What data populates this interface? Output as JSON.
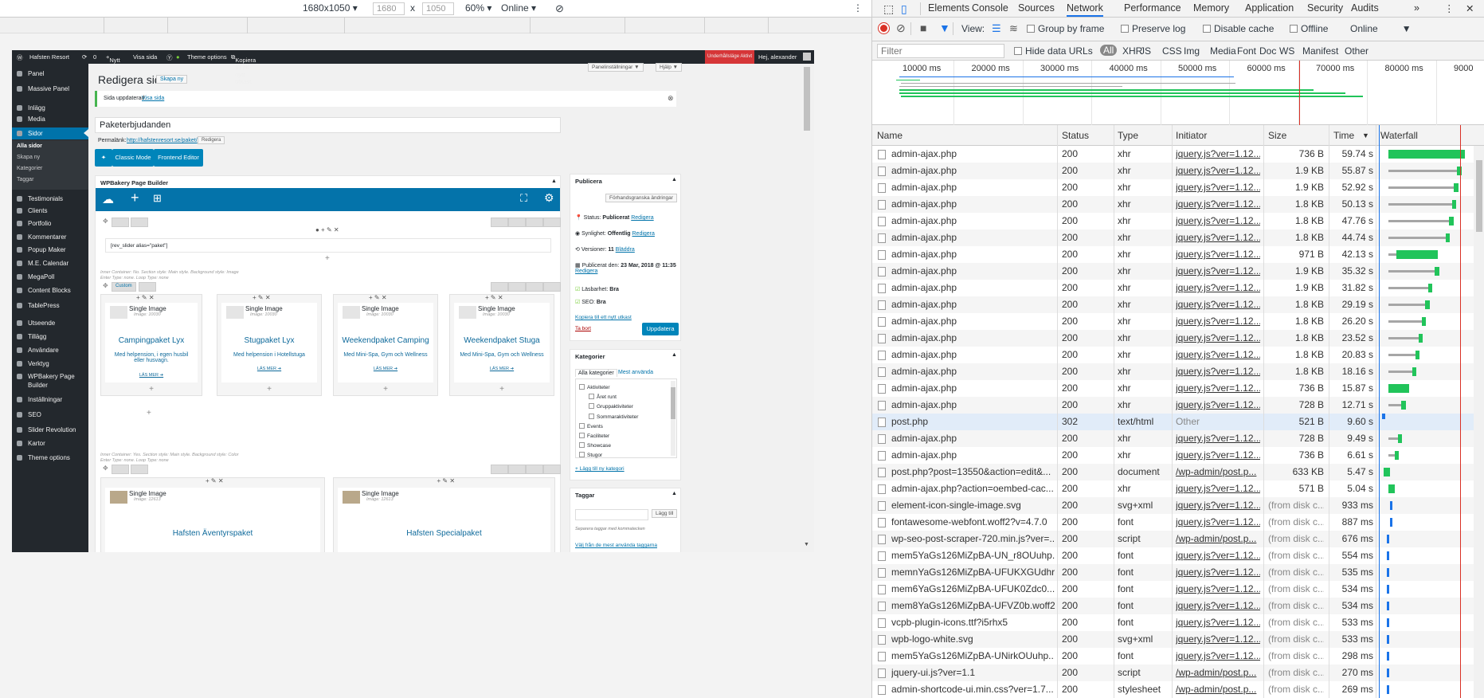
{
  "device_toolbar": {
    "preset": "1680x1050",
    "width": "1680",
    "x": "x",
    "height": "1050",
    "zoom": "60%",
    "network": "Online"
  },
  "wp": {
    "adminbar": {
      "site": "Hafsten Resort",
      "comments": "0",
      "new": "Nytt",
      "view": "Visa sida",
      "theme": "Theme options",
      "copy": "Kopiera till ett nytt utkast",
      "warn": "Underhållsläge Aktivt",
      "user": "Hej, alexander"
    },
    "menu": [
      {
        "label": "Panel",
        "icon": "dashboard-icon"
      },
      {
        "label": "Massive Panel",
        "icon": "panel-icon"
      },
      {
        "label": "Inlägg",
        "icon": "pin-icon"
      },
      {
        "label": "Media",
        "icon": "media-icon"
      },
      {
        "label": "Sidor",
        "icon": "pages-icon"
      },
      {
        "label": "Testimonials",
        "icon": "quote-icon"
      },
      {
        "label": "Clients",
        "icon": "clients-icon"
      },
      {
        "label": "Portfolio",
        "icon": "portfolio-icon"
      },
      {
        "label": "Kommentarer",
        "icon": "comment-icon"
      },
      {
        "label": "Popup Maker",
        "icon": "popup-icon"
      },
      {
        "label": "M.E. Calendar",
        "icon": "calendar-icon"
      },
      {
        "label": "MegaPoll",
        "icon": "poll-icon"
      },
      {
        "label": "Content Blocks",
        "icon": "blocks-icon"
      },
      {
        "label": "TablePress",
        "icon": "table-icon"
      },
      {
        "label": "Utseende",
        "icon": "brush-icon"
      },
      {
        "label": "Tillägg",
        "icon": "plugin-icon"
      },
      {
        "label": "Användare",
        "icon": "users-icon"
      },
      {
        "label": "Verktyg",
        "icon": "tools-icon"
      },
      {
        "label": "WPBakery Page Builder",
        "icon": "wpb-icon"
      },
      {
        "label": "Inställningar",
        "icon": "settings-icon"
      },
      {
        "label": "SEO",
        "icon": "seo-icon"
      },
      {
        "label": "Slider Revolution",
        "icon": "slider-icon"
      },
      {
        "label": "Kartor",
        "icon": "map-icon"
      },
      {
        "label": "Theme options",
        "icon": "theme-icon"
      }
    ],
    "submenu": [
      "Alla sidor",
      "Skapa ny",
      "Kategorier",
      "Taggar"
    ],
    "heading": "Redigera sida",
    "add_new": "Skapa ny",
    "screen_options": "Panelinställningar ▼",
    "help": "Hjälp ▼",
    "notice": "Sida uppdaterad.",
    "notice_link": "Visa sida",
    "title": "Paketerbjudanden",
    "permalink_label": "Permalänk:",
    "permalink": "http://hafstenresort.se/paket/",
    "edit": "Redigera",
    "classic_mode": "Classic Mode",
    "frontend_editor": "Frontend Editor",
    "wpb_title": "WPBakery Page Builder",
    "shortcode": "[rev_slider alias=\"paket\"]",
    "inner1": "Inner Container: No. Section style: Main style. Background style: Image",
    "inner1b": "Enter Type: none. Loop Type: none",
    "custom": "Custom",
    "cards": [
      {
        "img": "Single Image",
        "sub": "Image: 10030",
        "title": "Campingpaket Lyx",
        "desc": "Med helpension, i egen husbil eller husvagn.",
        "more": "LÄS MER ➔"
      },
      {
        "img": "Single Image",
        "sub": "Image: 10030",
        "title": "Stugpaket Lyx",
        "desc": "Med helpension i Hotellstuga",
        "more": "LÄS MER ➔"
      },
      {
        "img": "Single Image",
        "sub": "Image: 10030",
        "title": "Weekendpaket Camping",
        "desc": "Med Mini-Spa, Gym och Wellness",
        "more": "LÄS MER ➔"
      },
      {
        "img": "Single Image",
        "sub": "Image: 10030",
        "title": "Weekendpaket Stuga",
        "desc": "Med Mini-Spa, Gym och Wellness",
        "more": "LÄS MER ➔"
      }
    ],
    "inner2": "Inner Container: Yes. Section style: Main style. Background style: Color",
    "inner2b": "Enter Type: none. Loop Type: none",
    "cards2": [
      {
        "img": "Single Image",
        "sub": "Image: 12613",
        "title": "Hafsten Äventyrspaket"
      },
      {
        "img": "Single Image",
        "sub": "Image: 12613",
        "title": "Hafsten Specialpaket"
      }
    ],
    "publish": {
      "title": "Publicera",
      "preview": "Förhandsgranska ändringar",
      "status_l": "Status:",
      "status": "Publicerat",
      "vis_l": "Synlighet:",
      "vis": "Offentlig",
      "rev_l": "Versioner:",
      "rev": "11",
      "browse": "Bläddra",
      "pub_l": "Publicerat den:",
      "pub": "23 Mar, 2018 @ 11:35",
      "read_l": "Läsbarhet:",
      "read": "Bra",
      "seo_l": "SEO:",
      "seo": "Bra",
      "copy": "Kopiera till ett nytt utkast",
      "trash": "Ta bort",
      "update": "Uppdatera"
    },
    "categories": {
      "title": "Kategorier",
      "all": "Alla kategorier",
      "most": "Mest använda",
      "items": [
        "Aktiviteter",
        "Året runt",
        "Gruppaktiviteter",
        "Sommaraktiviteter",
        "Events",
        "Faciliteter",
        "Showcase",
        "Stugor"
      ],
      "add": "+ Lägg till ny kategori"
    },
    "tags": {
      "title": "Taggar",
      "add": "Lägg till",
      "hint": "Separera taggar med kommatecken",
      "choose": "Välj från de mest använda taggarna"
    }
  },
  "devtools": {
    "tabs": [
      "Elements",
      "Console",
      "Sources",
      "Network",
      "Performance",
      "Memory",
      "Application",
      "Security",
      "Audits"
    ],
    "active_tab": "Network",
    "view_label": "View:",
    "group_by_frame": "Group by frame",
    "preserve_log": "Preserve log",
    "disable_cache": "Disable cache",
    "offline": "Offline",
    "online": "Online",
    "filter_placeholder": "Filter",
    "hide_data_urls": "Hide data URLs",
    "filters": [
      "All",
      "XHR",
      "JS",
      "CSS",
      "Img",
      "Media",
      "Font",
      "Doc",
      "WS",
      "Manifest",
      "Other"
    ],
    "timeline_ticks": [
      "10000 ms",
      "20000 ms",
      "30000 ms",
      "40000 ms",
      "50000 ms",
      "60000 ms",
      "70000 ms",
      "80000 ms",
      "9000"
    ],
    "columns": [
      "Name",
      "Status",
      "Type",
      "Initiator",
      "Size",
      "Time",
      "Waterfall"
    ],
    "rows": [
      {
        "name": "admin-ajax.php",
        "status": "200",
        "type": "xhr",
        "init": "jquery.js?ver=1.12....",
        "size": "736 B",
        "time": "59.74 s"
      },
      {
        "name": "admin-ajax.php",
        "status": "200",
        "type": "xhr",
        "init": "jquery.js?ver=1.12....",
        "size": "1.9 KB",
        "time": "55.87 s"
      },
      {
        "name": "admin-ajax.php",
        "status": "200",
        "type": "xhr",
        "init": "jquery.js?ver=1.12....",
        "size": "1.9 KB",
        "time": "52.92 s"
      },
      {
        "name": "admin-ajax.php",
        "status": "200",
        "type": "xhr",
        "init": "jquery.js?ver=1.12....",
        "size": "1.8 KB",
        "time": "50.13 s"
      },
      {
        "name": "admin-ajax.php",
        "status": "200",
        "type": "xhr",
        "init": "jquery.js?ver=1.12....",
        "size": "1.8 KB",
        "time": "47.76 s"
      },
      {
        "name": "admin-ajax.php",
        "status": "200",
        "type": "xhr",
        "init": "jquery.js?ver=1.12....",
        "size": "1.8 KB",
        "time": "44.74 s"
      },
      {
        "name": "admin-ajax.php",
        "status": "200",
        "type": "xhr",
        "init": "jquery.js?ver=1.12....",
        "size": "971 B",
        "time": "42.13 s"
      },
      {
        "name": "admin-ajax.php",
        "status": "200",
        "type": "xhr",
        "init": "jquery.js?ver=1.12....",
        "size": "1.9 KB",
        "time": "35.32 s"
      },
      {
        "name": "admin-ajax.php",
        "status": "200",
        "type": "xhr",
        "init": "jquery.js?ver=1.12....",
        "size": "1.9 KB",
        "time": "31.82 s"
      },
      {
        "name": "admin-ajax.php",
        "status": "200",
        "type": "xhr",
        "init": "jquery.js?ver=1.12....",
        "size": "1.8 KB",
        "time": "29.19 s"
      },
      {
        "name": "admin-ajax.php",
        "status": "200",
        "type": "xhr",
        "init": "jquery.js?ver=1.12....",
        "size": "1.8 KB",
        "time": "26.20 s"
      },
      {
        "name": "admin-ajax.php",
        "status": "200",
        "type": "xhr",
        "init": "jquery.js?ver=1.12....",
        "size": "1.8 KB",
        "time": "23.52 s"
      },
      {
        "name": "admin-ajax.php",
        "status": "200",
        "type": "xhr",
        "init": "jquery.js?ver=1.12....",
        "size": "1.8 KB",
        "time": "20.83 s"
      },
      {
        "name": "admin-ajax.php",
        "status": "200",
        "type": "xhr",
        "init": "jquery.js?ver=1.12....",
        "size": "1.8 KB",
        "time": "18.16 s"
      },
      {
        "name": "admin-ajax.php",
        "status": "200",
        "type": "xhr",
        "init": "jquery.js?ver=1.12....",
        "size": "736 B",
        "time": "15.87 s"
      },
      {
        "name": "admin-ajax.php",
        "status": "200",
        "type": "xhr",
        "init": "jquery.js?ver=1.12....",
        "size": "728 B",
        "time": "12.71 s"
      },
      {
        "name": "post.php",
        "status": "302",
        "type": "text/html",
        "init": "Other",
        "size": "521 B",
        "time": "9.60 s"
      },
      {
        "name": "admin-ajax.php",
        "status": "200",
        "type": "xhr",
        "init": "jquery.js?ver=1.12....",
        "size": "728 B",
        "time": "9.49 s"
      },
      {
        "name": "admin-ajax.php",
        "status": "200",
        "type": "xhr",
        "init": "jquery.js?ver=1.12....",
        "size": "736 B",
        "time": "6.61 s"
      },
      {
        "name": "post.php?post=13550&action=edit&...",
        "status": "200",
        "type": "document",
        "init": "/wp-admin/post.p...",
        "size": "633 KB",
        "time": "5.47 s"
      },
      {
        "name": "admin-ajax.php?action=oembed-cac...",
        "status": "200",
        "type": "xhr",
        "init": "jquery.js?ver=1.12....",
        "size": "571 B",
        "time": "5.04 s"
      },
      {
        "name": "element-icon-single-image.svg",
        "status": "200",
        "type": "svg+xml",
        "init": "jquery.js?ver=1.12....",
        "size": "(from disk c...",
        "time": "933 ms"
      },
      {
        "name": "fontawesome-webfont.woff2?v=4.7.0",
        "status": "200",
        "type": "font",
        "init": "jquery.js?ver=1.12....",
        "size": "(from disk c...",
        "time": "887 ms"
      },
      {
        "name": "wp-seo-post-scraper-720.min.js?ver=...",
        "status": "200",
        "type": "script",
        "init": "/wp-admin/post.p...",
        "size": "(from disk c...",
        "time": "676 ms"
      },
      {
        "name": "mem5YaGs126MiZpBA-UN_r8OUuhp...",
        "status": "200",
        "type": "font",
        "init": "jquery.js?ver=1.12....",
        "size": "(from disk c...",
        "time": "554 ms"
      },
      {
        "name": "memnYaGs126MiZpBA-UFUKXGUdhr...",
        "status": "200",
        "type": "font",
        "init": "jquery.js?ver=1.12....",
        "size": "(from disk c...",
        "time": "535 ms"
      },
      {
        "name": "mem6YaGs126MiZpBA-UFUK0Zdc0...",
        "status": "200",
        "type": "font",
        "init": "jquery.js?ver=1.12....",
        "size": "(from disk c...",
        "time": "534 ms"
      },
      {
        "name": "mem8YaGs126MiZpBA-UFVZ0b.woff2",
        "status": "200",
        "type": "font",
        "init": "jquery.js?ver=1.12....",
        "size": "(from disk c...",
        "time": "534 ms"
      },
      {
        "name": "vcpb-plugin-icons.ttf?i5rhx5",
        "status": "200",
        "type": "font",
        "init": "jquery.js?ver=1.12....",
        "size": "(from disk c...",
        "time": "533 ms"
      },
      {
        "name": "wpb-logo-white.svg",
        "status": "200",
        "type": "svg+xml",
        "init": "jquery.js?ver=1.12....",
        "size": "(from disk c...",
        "time": "533 ms"
      },
      {
        "name": "mem5YaGs126MiZpBA-UNirkOUuhp...",
        "status": "200",
        "type": "font",
        "init": "jquery.js?ver=1.12....",
        "size": "(from disk c...",
        "time": "298 ms"
      },
      {
        "name": "jquery-ui.js?ver=1.1",
        "status": "200",
        "type": "script",
        "init": "/wp-admin/post.p...",
        "size": "(from disk c...",
        "time": "270 ms"
      },
      {
        "name": "admin-shortcode-ui.min.css?ver=1.7...",
        "status": "200",
        "type": "stylesheet",
        "init": "/wp-admin/post.p...",
        "size": "(from disk c...",
        "time": "269 ms"
      }
    ],
    "colors": {
      "accent": "#1a73e8",
      "waterfall_green": "#21c45a",
      "waterfall_gray": "#a6a6a6",
      "waterfall_blue": "#1a73e8",
      "record_red": "#d93025",
      "wp_blue": "#0073aa",
      "wpb_blue": "#0473aa"
    }
  }
}
